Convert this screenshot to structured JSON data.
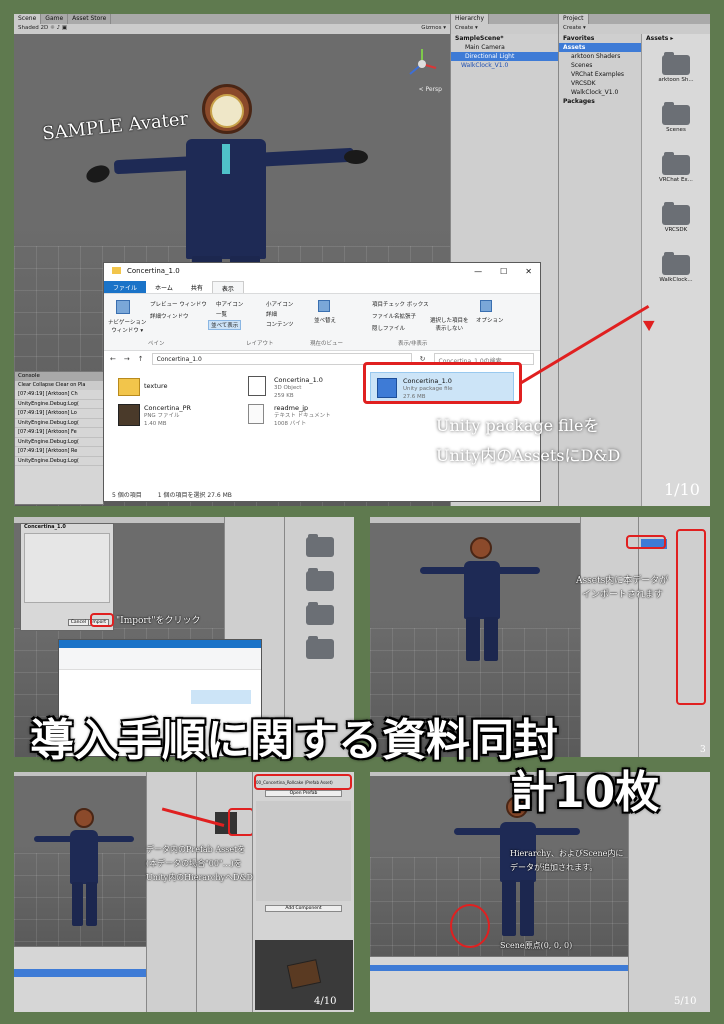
{
  "main": {
    "scene_tabs": [
      "Scene",
      "Game",
      "Asset Store"
    ],
    "scene_toolbar": "Shaded   2D   ☼   ♪   ▣",
    "gizmos": "Gizmos  ▾",
    "persp": "< Persp",
    "sample_caption": "SAMPLE Avater",
    "hierarchy": {
      "tab": "Hierarchy",
      "create": "Create ▾",
      "scene": "SampleScene*",
      "items": [
        "Main Camera",
        "Directional Light",
        "WalkClock_V1.0"
      ]
    },
    "project": {
      "tab": "Project",
      "create": "Create ▾",
      "favorites": "Favorites",
      "assets_header": "Assets ▸",
      "tree": [
        "Assets",
        "arktoon Shaders",
        "Scenes",
        "VRChat Examples",
        "VRCSDK",
        "WalkClock_V1.0",
        "Packages"
      ],
      "thumbs": [
        "arktoon Sh...",
        "Scenes",
        "VRChat Ex...",
        "VRCSDK",
        "WalkClock..."
      ]
    },
    "console": {
      "tab": "Console",
      "bar": "Clear  Collapse  Clear on Pla",
      "lines": [
        "[07:49:19] [Arktoon] Ch",
        "UnityEngine.Debug:Log(",
        "[07:49:19] [Arktoon] Lo",
        "UnityEngine.Debug:Log(",
        "[07:49:19] [Arktoon] Fe",
        "UnityEngine.Debug:Log(",
        "[07:49:19] [Arktoon] Re",
        "UnityEngine.Debug:Log("
      ]
    },
    "explorer": {
      "title": "Concertina_1.0",
      "tabs": [
        "ファイル",
        "ホーム",
        "共有",
        "表示"
      ],
      "ribbon": {
        "nav_pane": "ナビゲーション\nウィンドウ ▾",
        "preview": "プレビュー ウィンドウ",
        "details": "詳細ウィンドウ",
        "pane_group": "ペイン",
        "icons_medium": "中アイコン",
        "icons_small": "小アイコン",
        "list": "一覧",
        "detail_view": "詳細",
        "tiles": "並べて表示",
        "content": "コンテンツ",
        "layout_group": "レイアウト",
        "sort": "並べ替え",
        "current_group": "現在のビュー",
        "check_box": "項目チェック ボックス",
        "ext": "ファイル名拡張子",
        "hidden": "隠しファイル",
        "hide_selected": "選択した項目を\n表示しない",
        "options": "オプション",
        "show_group": "表示/非表示"
      },
      "address": "Concertina_1.0",
      "search": "Concertina_1.0の検索",
      "files": [
        {
          "name": "texture",
          "sub": ""
        },
        {
          "name": "Concertina_PR",
          "sub": "PNG ファイル\n1.40 MB"
        },
        {
          "name": "Concertina_1.0",
          "sub": "3D Object\n259 KB"
        },
        {
          "name": "readme_jp",
          "sub": "テキスト ドキュメント\n1008 バイト"
        },
        {
          "name": "Concertina_1.0",
          "sub": "Unity package file\n27.6 MB"
        }
      ],
      "status_count": "5 個の項目",
      "status_selected": "1 個の項目を選択  27.6 MB"
    },
    "instruction_line1": "Unity package fileを",
    "instruction_line2": "Unity内のAssetsにD&D",
    "page": "1/10"
  },
  "thumb2": {
    "caption": "\"Import\"をクリック",
    "dialog_title": "Concertina_1.0",
    "import_button": "Import",
    "cancel_button": "Cancel"
  },
  "thumb3": {
    "caption_line1": "Assets内に本データが",
    "caption_line2": "インポートされます",
    "page": "3"
  },
  "thumb4": {
    "caption_line1": "データ内のPrefab Assetを",
    "caption_line2": "(本データの場合\"00\"…)を",
    "caption_line3": "Unity内のHierarchyへD&D",
    "inspector_title": "00_Concertina_Rollcake (Prefab Asset)",
    "open_prefab": "Open Prefab",
    "add_component": "Add Component",
    "page": "4/10"
  },
  "thumb5": {
    "caption_line1": "Hierarchy、およびScene内に",
    "caption_line2": "データが追加されます。",
    "origin": "Scene原点(0, 0, 0)",
    "page": "5/10"
  },
  "banner_line1": "導入手順に関する資料同封",
  "banner_line2": "計10枚",
  "colors": {
    "background": "#5f7a4f",
    "highlight_red": "#e02020",
    "unity_select": "#3e7bd6"
  }
}
